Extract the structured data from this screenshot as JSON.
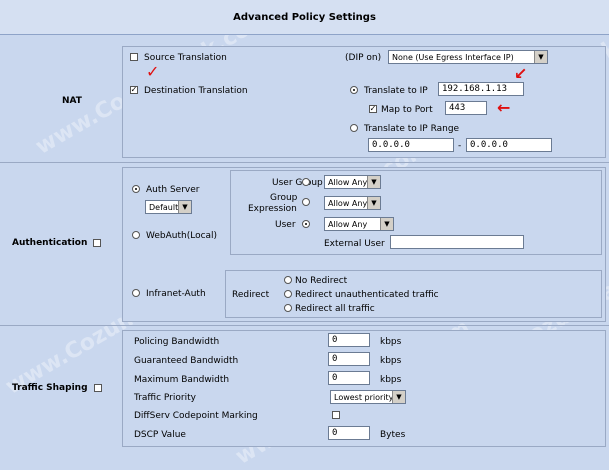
{
  "title": "Advanced Policy Settings",
  "watermark": "www.CozumPark.com",
  "nat": {
    "section_label": "NAT",
    "source_translation": {
      "label": "Source Translation",
      "checked": false
    },
    "dip_label": "(DIP on)",
    "dip_select": "None (Use Egress Interface IP)",
    "destination_translation": {
      "label": "Destination Translation",
      "checked": true
    },
    "translate_to_ip": {
      "label": "Translate to IP",
      "selected": true,
      "value": "192.168.1.13"
    },
    "map_to_port": {
      "label": "Map to Port",
      "checked": true,
      "value": "443"
    },
    "translate_to_ip_range": {
      "label": "Translate to IP Range",
      "selected": false,
      "from": "0.0.0.0",
      "dash": "-",
      "to": "0.0.0.0"
    }
  },
  "authentication": {
    "section_label": "Authentication",
    "auth_server": {
      "label": "Auth Server",
      "selected": true,
      "select": "Default"
    },
    "user_group": {
      "label": "User Group",
      "value": "Allow Any"
    },
    "group_expression": {
      "label1": "Group",
      "label2": "Expression",
      "value": "Allow Any"
    },
    "user": {
      "label": "User",
      "value": "Allow Any"
    },
    "external_user": {
      "label": "External User",
      "value": ""
    },
    "webauth": {
      "label": "WebAuth(Local)"
    },
    "infranet": {
      "label": "Infranet-Auth"
    },
    "redirect": {
      "label": "Redirect",
      "options": [
        "No Redirect",
        "Redirect unauthenticated traffic",
        "Redirect all traffic"
      ]
    }
  },
  "traffic_shaping": {
    "section_label": "Traffic Shaping",
    "policing_bandwidth": {
      "label": "Policing Bandwidth",
      "value": "0",
      "unit": "kbps"
    },
    "guaranteed_bandwidth": {
      "label": "Guaranteed Bandwidth",
      "value": "0",
      "unit": "kbps"
    },
    "maximum_bandwidth": {
      "label": "Maximum Bandwidth",
      "value": "0",
      "unit": "kbps"
    },
    "traffic_priority": {
      "label": "Traffic Priority",
      "value": "Lowest priority"
    },
    "diffserv": {
      "label": "DiffServ Codepoint Marking"
    },
    "dscp": {
      "label": "DSCP Value",
      "value": "0",
      "unit": "Bytes"
    }
  }
}
